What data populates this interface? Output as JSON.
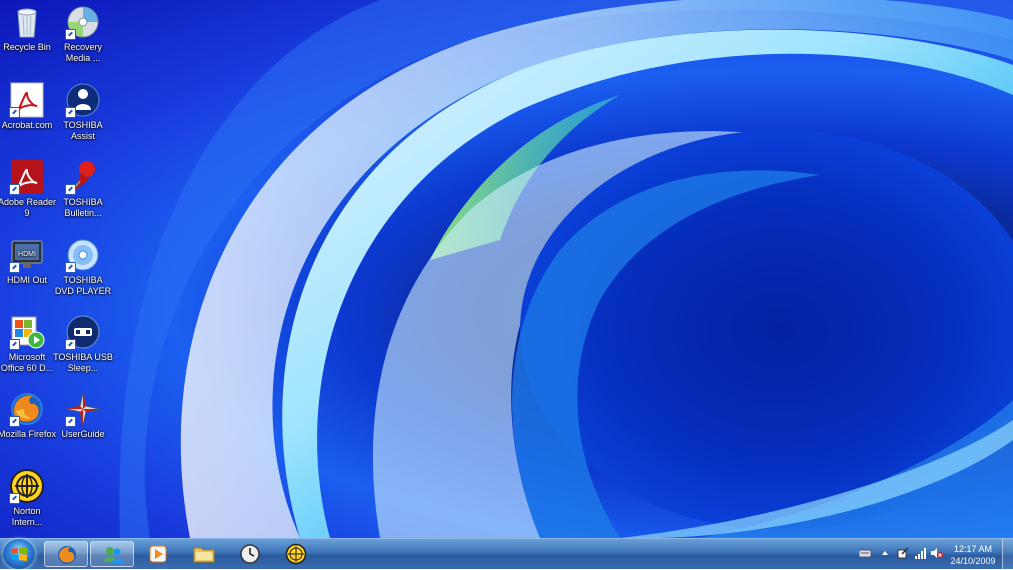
{
  "desktop": {
    "icons": [
      {
        "label": "Recycle Bin",
        "icon": "recycle-bin-icon"
      },
      {
        "label": "Recovery Media ...",
        "icon": "recovery-media-icon"
      },
      {
        "label": "Acrobat.com",
        "icon": "acrobat-com-icon"
      },
      {
        "label": "TOSHIBA Assist",
        "icon": "toshiba-assist-icon"
      },
      {
        "label": "Adobe Reader 9",
        "icon": "adobe-reader-icon"
      },
      {
        "label": "TOSHIBA Bulletin...",
        "icon": "toshiba-bulletin-icon"
      },
      {
        "label": "HDMI Out",
        "icon": "hdmi-out-icon"
      },
      {
        "label": "TOSHIBA DVD PLAYER",
        "icon": "toshiba-dvd-player-icon"
      },
      {
        "label": "Microsoft Office 60 D...",
        "icon": "microsoft-office-icon"
      },
      {
        "label": "TOSHIBA USB Sleep...",
        "icon": "toshiba-usb-sleep-icon"
      },
      {
        "label": "Mozilla Firefox",
        "icon": "firefox-icon"
      },
      {
        "label": "UserGuide",
        "icon": "userguide-icon"
      },
      {
        "label": "Norton Intern...",
        "icon": "norton-internet-icon"
      }
    ]
  },
  "taskbar": {
    "pinned": [
      {
        "name": "firefox",
        "icon": "firefox-icon",
        "active": true
      },
      {
        "name": "windows-live-messenger",
        "icon": "messenger-icon",
        "active": true
      },
      {
        "name": "media-player",
        "icon": "media-player-icon",
        "active": false
      },
      {
        "name": "windows-explorer",
        "icon": "folder-icon",
        "active": false
      },
      {
        "name": "clock-gadget",
        "icon": "clock-icon",
        "active": false
      },
      {
        "name": "norton",
        "icon": "norton-icon",
        "active": false
      }
    ],
    "tray": {
      "time": "12:17 AM",
      "date": "24/10/2009",
      "icons": [
        "keyboard-icon",
        "show-hidden-icons-arrow-icon",
        "action-center-icon",
        "network-signal-icon",
        "volume-muted-icon"
      ]
    }
  }
}
